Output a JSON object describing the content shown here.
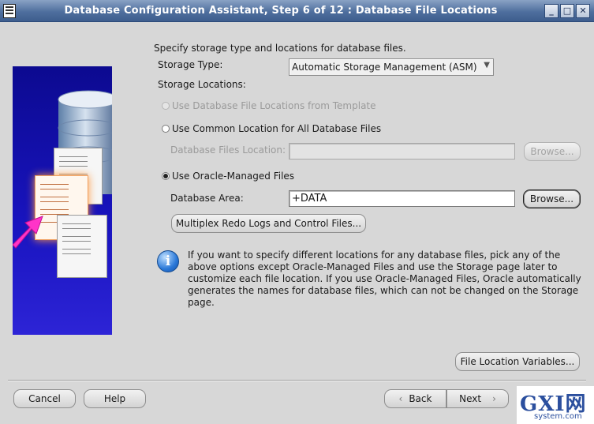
{
  "window": {
    "title": "Database Configuration Assistant, Step 6 of 12 : Database File Locations",
    "controls": {
      "minimize": "_",
      "maximize": "□",
      "close": "✕"
    }
  },
  "form": {
    "intro": "Specify storage type and locations for database files.",
    "storage_type_label": "Storage Type:",
    "storage_type_value": "Automatic Storage Management (ASM)",
    "storage_locations_label": "Storage Locations:",
    "radio_template": "Use Database File Locations from Template",
    "radio_common": "Use Common Location for All Database Files",
    "db_files_location_label": "Database Files Location:",
    "db_files_location_value": "",
    "browse_disabled_label": "Browse...",
    "radio_omf": "Use Oracle-Managed Files",
    "db_area_label": "Database Area:",
    "db_area_value": "+DATA",
    "browse_label": "Browse...",
    "multiplex_label": "Multiplex Redo Logs and Control Files...",
    "info_text": "If you want to specify different locations for any database files, pick any of the above options except Oracle-Managed Files and use the Storage page later to customize each file location. If you use Oracle-Managed Files, Oracle automatically generates the names for database files, which can not be changed on the Storage page.",
    "file_location_vars_label": "File Location Variables..."
  },
  "footer": {
    "cancel": "Cancel",
    "help": "Help",
    "back": "Back",
    "next": "Next"
  },
  "watermark": {
    "logo": "GXI网",
    "site": "system.com"
  },
  "colors": {
    "titlebar": "#4f6f9e",
    "art_panel": "#1914c0",
    "info_icon": "#2a78d8"
  }
}
